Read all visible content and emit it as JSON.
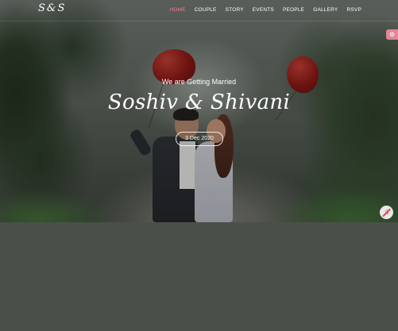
{
  "logo": {
    "text": "S&S"
  },
  "nav": {
    "items": [
      {
        "label": "HOME",
        "active": true
      },
      {
        "label": "COUPLE"
      },
      {
        "label": "STORY"
      },
      {
        "label": "EVENTS"
      },
      {
        "label": "PEOPLE"
      },
      {
        "label": "GALLERY"
      },
      {
        "label": "RSVP"
      }
    ]
  },
  "hero": {
    "subtitle": "We are Getting Married",
    "names": "Soshiv & Shivani",
    "date": "3 Dec 2020"
  },
  "widgets": {
    "settings_icon": "gear-icon",
    "music_icon": "music-muted-icon"
  },
  "colors": {
    "accent": "#e8848e",
    "overlay": "#4b4f49"
  }
}
